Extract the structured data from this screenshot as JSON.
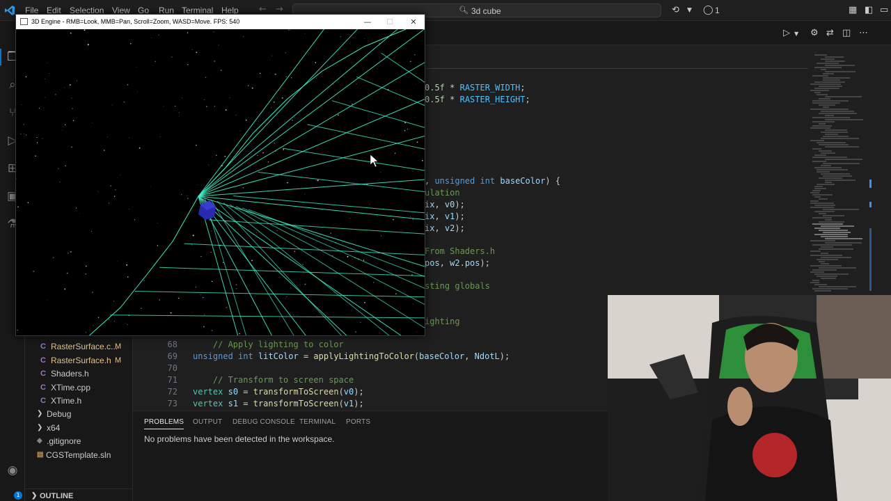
{
  "titlebar": {
    "menu": [
      "File",
      "Edit",
      "Selection",
      "View",
      "Go",
      "Run",
      "Terminal",
      "Help"
    ],
    "search_text": "3d cube",
    "notification_count": "1"
  },
  "engine_window": {
    "title": "3D Engine - RMB=Look, MMB=Pan, Scroll=Zoom, WASD=Move. FPS: 540",
    "minimize_glyph": "—",
    "maximize_glyph": "☐",
    "close_glyph": "✕"
  },
  "explorer": {
    "files": [
      {
        "icon": "C",
        "name": "RasterSurface.c...",
        "status": "M"
      },
      {
        "icon": "C",
        "name": "RasterSurface.h",
        "status": "M"
      },
      {
        "icon": "C",
        "name": "Shaders.h",
        "status": ""
      },
      {
        "icon": "C",
        "name": "XTime.cpp",
        "status": ""
      },
      {
        "icon": "C",
        "name": "XTime.h",
        "status": ""
      }
    ],
    "folders": [
      "Debug",
      "x64"
    ],
    "extra_files": [
      ".gitignore",
      "CGSTemplate.sln"
    ],
    "outline_label": "OUTLINE"
  },
  "editor": {
    "visible_fragments": [
      {
        "text": "0.5f * RASTER_WIDTH;"
      },
      {
        "text": "0.5f * RASTER_HEIGHT;"
      },
      {
        "text": ", unsigned int baseColor) {"
      },
      {
        "text": "ulation"
      },
      {
        "text": "ix, v0);"
      },
      {
        "text": "ix, v1);"
      },
      {
        "text": "ix, v2);"
      },
      {
        "text": "From Shaders.h"
      },
      {
        "text": "pos, w2.pos);"
      },
      {
        "text": "sting globals"
      },
      {
        "text": "ighting"
      }
    ],
    "lines": [
      {
        "num": "68",
        "text": "    // Apply lighting to color"
      },
      {
        "num": "69",
        "text": "    unsigned int litColor = applyLightingToColor(baseColor, NdotL);"
      },
      {
        "num": "70",
        "text": ""
      },
      {
        "num": "71",
        "text": "    // Transform to screen space"
      },
      {
        "num": "72",
        "text": "    vertex s0 = transformToScreen(v0);"
      },
      {
        "num": "73",
        "text": "    vertex s1 = transformToScreen(v1);"
      }
    ]
  },
  "panel": {
    "tabs": [
      "PROBLEMS",
      "OUTPUT",
      "DEBUG CONSOLE",
      "TERMINAL",
      "PORTS"
    ],
    "message": "No problems have been detected in the workspace."
  },
  "colors": {
    "grid": "#3ff0c8",
    "cube": "#2a2ab0",
    "accent": "#0078d4"
  },
  "icons": [
    "vscode-logo-icon",
    "search-icon",
    "explorer-icon",
    "source-control-icon",
    "run-debug-icon",
    "extensions-icon",
    "remote-icon",
    "testing-icon",
    "account-icon",
    "settings-icon"
  ]
}
